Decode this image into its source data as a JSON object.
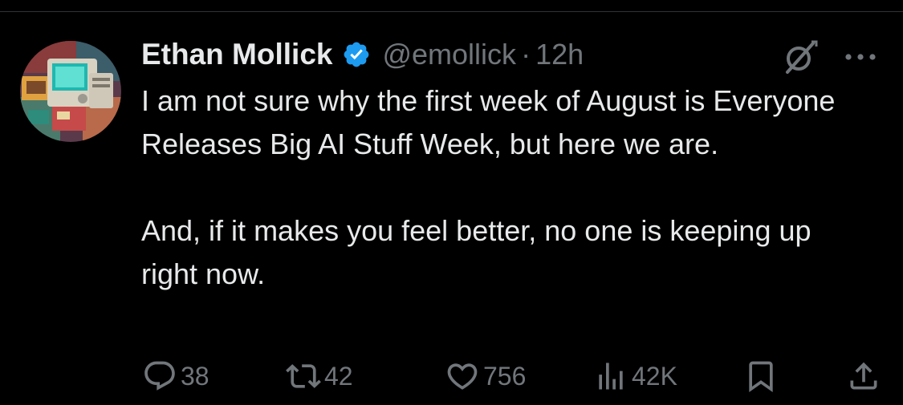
{
  "tweet": {
    "author_name": "Ethan Mollick",
    "handle": "@emollick",
    "separator": "·",
    "timestamp": "12h",
    "verified": true,
    "text_paragraphs": [
      "I am not sure why the first week of August is Everyone Releases Big AI Stuff Week, but here we are.",
      "And, if it makes you feel better, no one is keeping up right now."
    ]
  },
  "actions": {
    "replies": "38",
    "reposts": "42",
    "likes": "756",
    "views": "42K"
  },
  "icons": {
    "verified": "verified-badge-icon",
    "grok": "grok-icon",
    "more": "more-icon",
    "reply": "reply-icon",
    "repost": "repost-icon",
    "like": "heart-icon",
    "views": "views-icon",
    "bookmark": "bookmark-icon",
    "share": "share-icon"
  },
  "colors": {
    "background": "#000000",
    "primary_text": "#e7e9ea",
    "secondary_text": "#71767b",
    "verified_blue": "#1d9bf0",
    "divider": "#2f3336"
  }
}
